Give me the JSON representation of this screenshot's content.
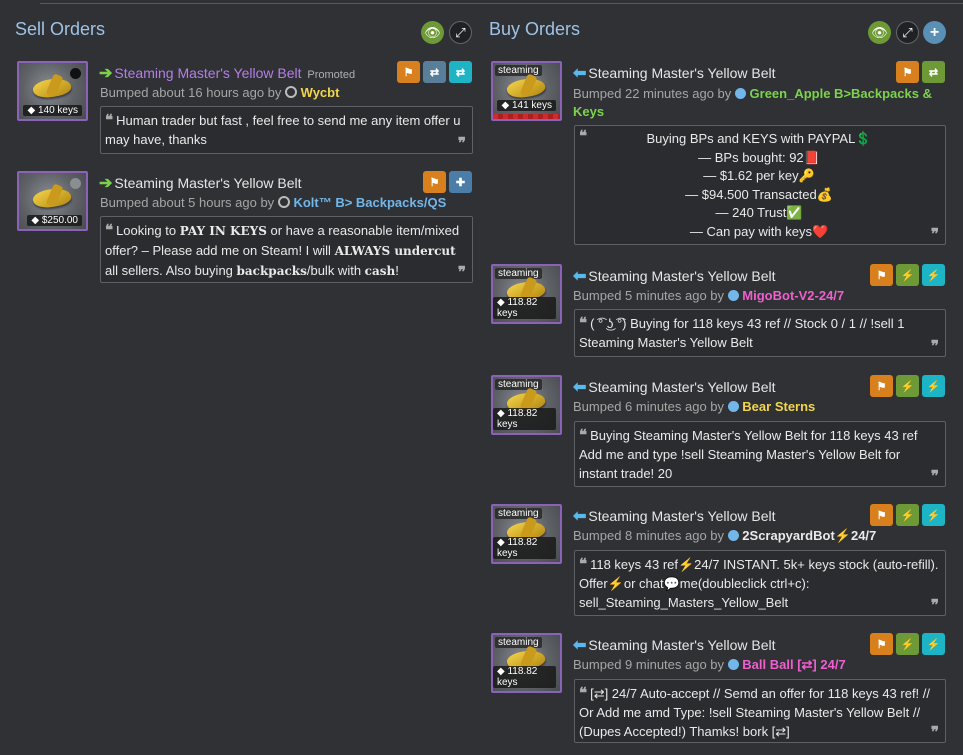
{
  "sell": {
    "title": "Sell Orders",
    "listings": [
      {
        "price": "140 keys",
        "title": "Steaming Master's Yellow Belt",
        "promoted": "Promoted",
        "bumped": "Bumped about 16 hours ago by",
        "user": "Wycbt",
        "msg": "Human trader but fast , feel free to send me any item offer u may have, thanks"
      },
      {
        "price": "$250.00",
        "title": "Steaming Master's Yellow Belt",
        "bumped": "Bumped about 5 hours ago by",
        "user": "Kolt™ B> Backpacks/QS",
        "msg_parts": [
          "Looking to ",
          "PAY IN KEYS",
          " or have a reasonable item/mixed offer? – Please add me on Steam! I will ",
          "ALWAYS undercut",
          " all sellers. Also buying ",
          "backpacks",
          "/bulk with ",
          "cash",
          "!"
        ]
      }
    ]
  },
  "buy": {
    "title": "Buy Orders",
    "quality": "steaming",
    "listings": [
      {
        "price": "141 keys",
        "title": "Steaming Master's Yellow Belt",
        "bumped": "Bumped 22 minutes ago by",
        "user": "Green_Apple B>Backpacks & Keys",
        "lines": [
          "Buying BPs and KEYS with PAYPAL💲",
          "— BPs bought: 92📕",
          "— $1.62 per key🔑",
          "— $94.500 Transacted💰",
          "— 240 Trust✅",
          "— Can pay with keys❤️"
        ]
      },
      {
        "price": "118.82 keys",
        "title": "Steaming Master's Yellow Belt",
        "bumped": "Bumped 5 minutes ago by",
        "user": "MigoBot-V2-24/7",
        "msg": "( ͡° ͜ʖ ͡°) Buying for 118 keys 43 ref // Stock 0 / 1 // !sell 1 Steaming Master's Yellow Belt"
      },
      {
        "price": "118.82 keys",
        "title": "Steaming Master's Yellow Belt",
        "bumped": "Bumped 6 minutes ago by",
        "user": "Bear Sterns",
        "msg": "Buying Steaming Master's Yellow Belt for 118 keys 43 ref Add me and type !sell Steaming Master's Yellow Belt for instant trade! 20"
      },
      {
        "price": "118.82 keys",
        "title": "Steaming Master's Yellow Belt",
        "bumped": "Bumped 8 minutes ago by",
        "user": "2ScrapyardBot⚡24/7",
        "msg": "118 keys 43 ref⚡24/7 INSTANT. 5k+ keys stock (auto-refill). Offer⚡or chat💬me(doubleclick ctrl+c): sell_Steaming_Masters_Yellow_Belt"
      },
      {
        "price": "118.82 keys",
        "title": "Steaming Master's Yellow Belt",
        "bumped": "Bumped 9 minutes ago by",
        "user": "Ball Ball [⇄] 24/7",
        "msg": "[⇄] 24/7 Auto-accept // Semd an offer for 118 keys 43 ref! // Or Add me amd Type: !sell Steaming Master's Yellow Belt // (Dupes Accepted!) Thamks! bork [⇄]"
      }
    ]
  },
  "icons": {
    "eye": "👁",
    "expand": "⤢",
    "plus": "+",
    "flag": "⚑",
    "exchange": "⇄",
    "add_friend": "👤",
    "lightning": "⚡",
    "tag": "🏷"
  },
  "colors": {
    "background": "#2f3134",
    "title_blue": "#9fc3e6",
    "item_border_purple": "#8a62b8",
    "flag_orange": "#d8801e",
    "teal": "#1db5c6",
    "lime": "#6d9a36"
  }
}
